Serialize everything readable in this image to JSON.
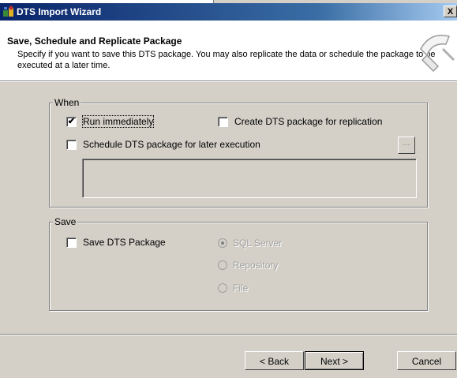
{
  "window": {
    "title": "DTS Import Wizard",
    "close_label": "X"
  },
  "header": {
    "title": "Save, Schedule and Replicate Package",
    "description": "Specify if you want to save this DTS package.  You may also replicate the data or schedule the package to be executed at a later time."
  },
  "when_group": {
    "legend": "When",
    "run_immediately": {
      "label": "Run immediately",
      "checked": true
    },
    "create_replication": {
      "label": "Create DTS package for replication",
      "checked": false
    },
    "schedule": {
      "label": "Schedule DTS package for later execution",
      "checked": false
    },
    "ellipsis_label": "..."
  },
  "save_group": {
    "legend": "Save",
    "save_package": {
      "label": "Save DTS Package",
      "checked": false
    },
    "options": [
      {
        "label": "SQL Server",
        "selected": true
      },
      {
        "label": "Repository",
        "selected": false
      },
      {
        "label": "File",
        "selected": false
      }
    ]
  },
  "buttons": {
    "back": "< Back",
    "next": "Next >",
    "cancel": "Cancel"
  }
}
